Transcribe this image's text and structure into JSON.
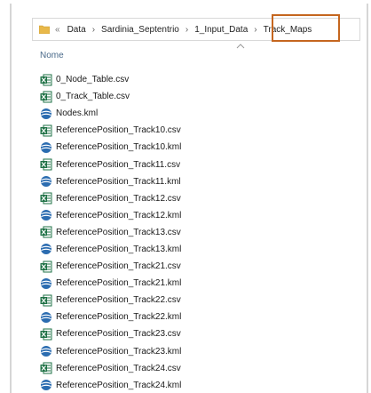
{
  "breadcrumb": {
    "overflow": "«",
    "items": [
      "Data",
      "Sardinia_Septentrio",
      "1_Input_Data",
      "Track_Maps"
    ],
    "separator": "›"
  },
  "columns": {
    "name": "Nome"
  },
  "colors": {
    "highlight": "#c5661f",
    "excel_green": "#1e7145",
    "kml_blue": "#2b6cb0",
    "folder_yellow": "#e8b84a"
  },
  "files": [
    {
      "name": "0_Node_Table.csv",
      "type": "csv"
    },
    {
      "name": "0_Track_Table.csv",
      "type": "csv"
    },
    {
      "name": "Nodes.kml",
      "type": "kml"
    },
    {
      "name": "ReferencePosition_Track10.csv",
      "type": "csv"
    },
    {
      "name": "ReferencePosition_Track10.kml",
      "type": "kml"
    },
    {
      "name": "ReferencePosition_Track11.csv",
      "type": "csv"
    },
    {
      "name": "ReferencePosition_Track11.kml",
      "type": "kml"
    },
    {
      "name": "ReferencePosition_Track12.csv",
      "type": "csv"
    },
    {
      "name": "ReferencePosition_Track12.kml",
      "type": "kml"
    },
    {
      "name": "ReferencePosition_Track13.csv",
      "type": "csv"
    },
    {
      "name": "ReferencePosition_Track13.kml",
      "type": "kml"
    },
    {
      "name": "ReferencePosition_Track21.csv",
      "type": "csv"
    },
    {
      "name": "ReferencePosition_Track21.kml",
      "type": "kml"
    },
    {
      "name": "ReferencePosition_Track22.csv",
      "type": "csv"
    },
    {
      "name": "ReferencePosition_Track22.kml",
      "type": "kml"
    },
    {
      "name": "ReferencePosition_Track23.csv",
      "type": "csv"
    },
    {
      "name": "ReferencePosition_Track23.kml",
      "type": "kml"
    },
    {
      "name": "ReferencePosition_Track24.csv",
      "type": "csv"
    },
    {
      "name": "ReferencePosition_Track24.kml",
      "type": "kml"
    }
  ]
}
